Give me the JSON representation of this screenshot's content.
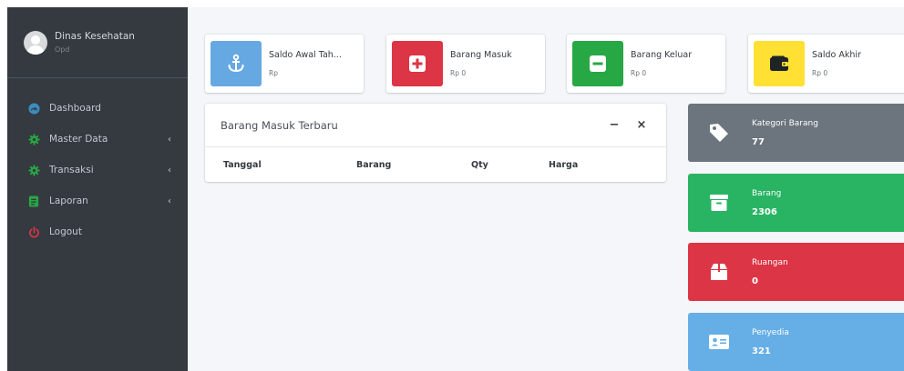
{
  "sidebar": {
    "user": {
      "name": "Dinas Kesehatan",
      "subtitle": "Opd"
    },
    "items": [
      {
        "label": "Dashboard",
        "icon": "dashboard-icon",
        "color": "#3c8dbc",
        "has_submenu": false
      },
      {
        "label": "Master Data",
        "icon": "gear-icon",
        "color": "#28a745",
        "has_submenu": true
      },
      {
        "label": "Transaksi",
        "icon": "gear-icon",
        "color": "#28a745",
        "has_submenu": true
      },
      {
        "label": "Laporan",
        "icon": "document-icon",
        "color": "#28a745",
        "has_submenu": true
      },
      {
        "label": "Logout",
        "icon": "power-icon",
        "color": "#dc3545",
        "has_submenu": false
      }
    ],
    "chevron": "‹"
  },
  "info_boxes": [
    {
      "title": "Saldo Awal Tah...",
      "value": "Rp",
      "icon": "anchor-icon",
      "color": "#66a8e2"
    },
    {
      "title": "Barang Masuk",
      "value": "Rp 0",
      "icon": "plus-square-icon",
      "color": "#dc3545"
    },
    {
      "title": "Barang Keluar",
      "value": "Rp 0",
      "icon": "minus-square-icon",
      "color": "#28a745"
    },
    {
      "title": "Saldo Akhir",
      "value": "Rp 0",
      "icon": "wallet-icon",
      "color": "#ffe033"
    }
  ],
  "recent_card": {
    "title": "Barang Masuk Terbaru",
    "collapse_label": "−",
    "close_label": "×",
    "columns": [
      "Tanggal",
      "Barang",
      "Qty",
      "Harga"
    ]
  },
  "small_boxes": [
    {
      "label": "Kategori Barang",
      "value": "77",
      "icon": "tag-icon",
      "color": "#6c757d"
    },
    {
      "label": "Barang",
      "value": "2306",
      "icon": "archive-icon",
      "color": "#28b463"
    },
    {
      "label": "Ruangan",
      "value": "0",
      "icon": "box-icon",
      "color": "#dc3545"
    },
    {
      "label": "Penyedia",
      "value": "321",
      "icon": "id-card-icon",
      "color": "#66aee6"
    }
  ]
}
